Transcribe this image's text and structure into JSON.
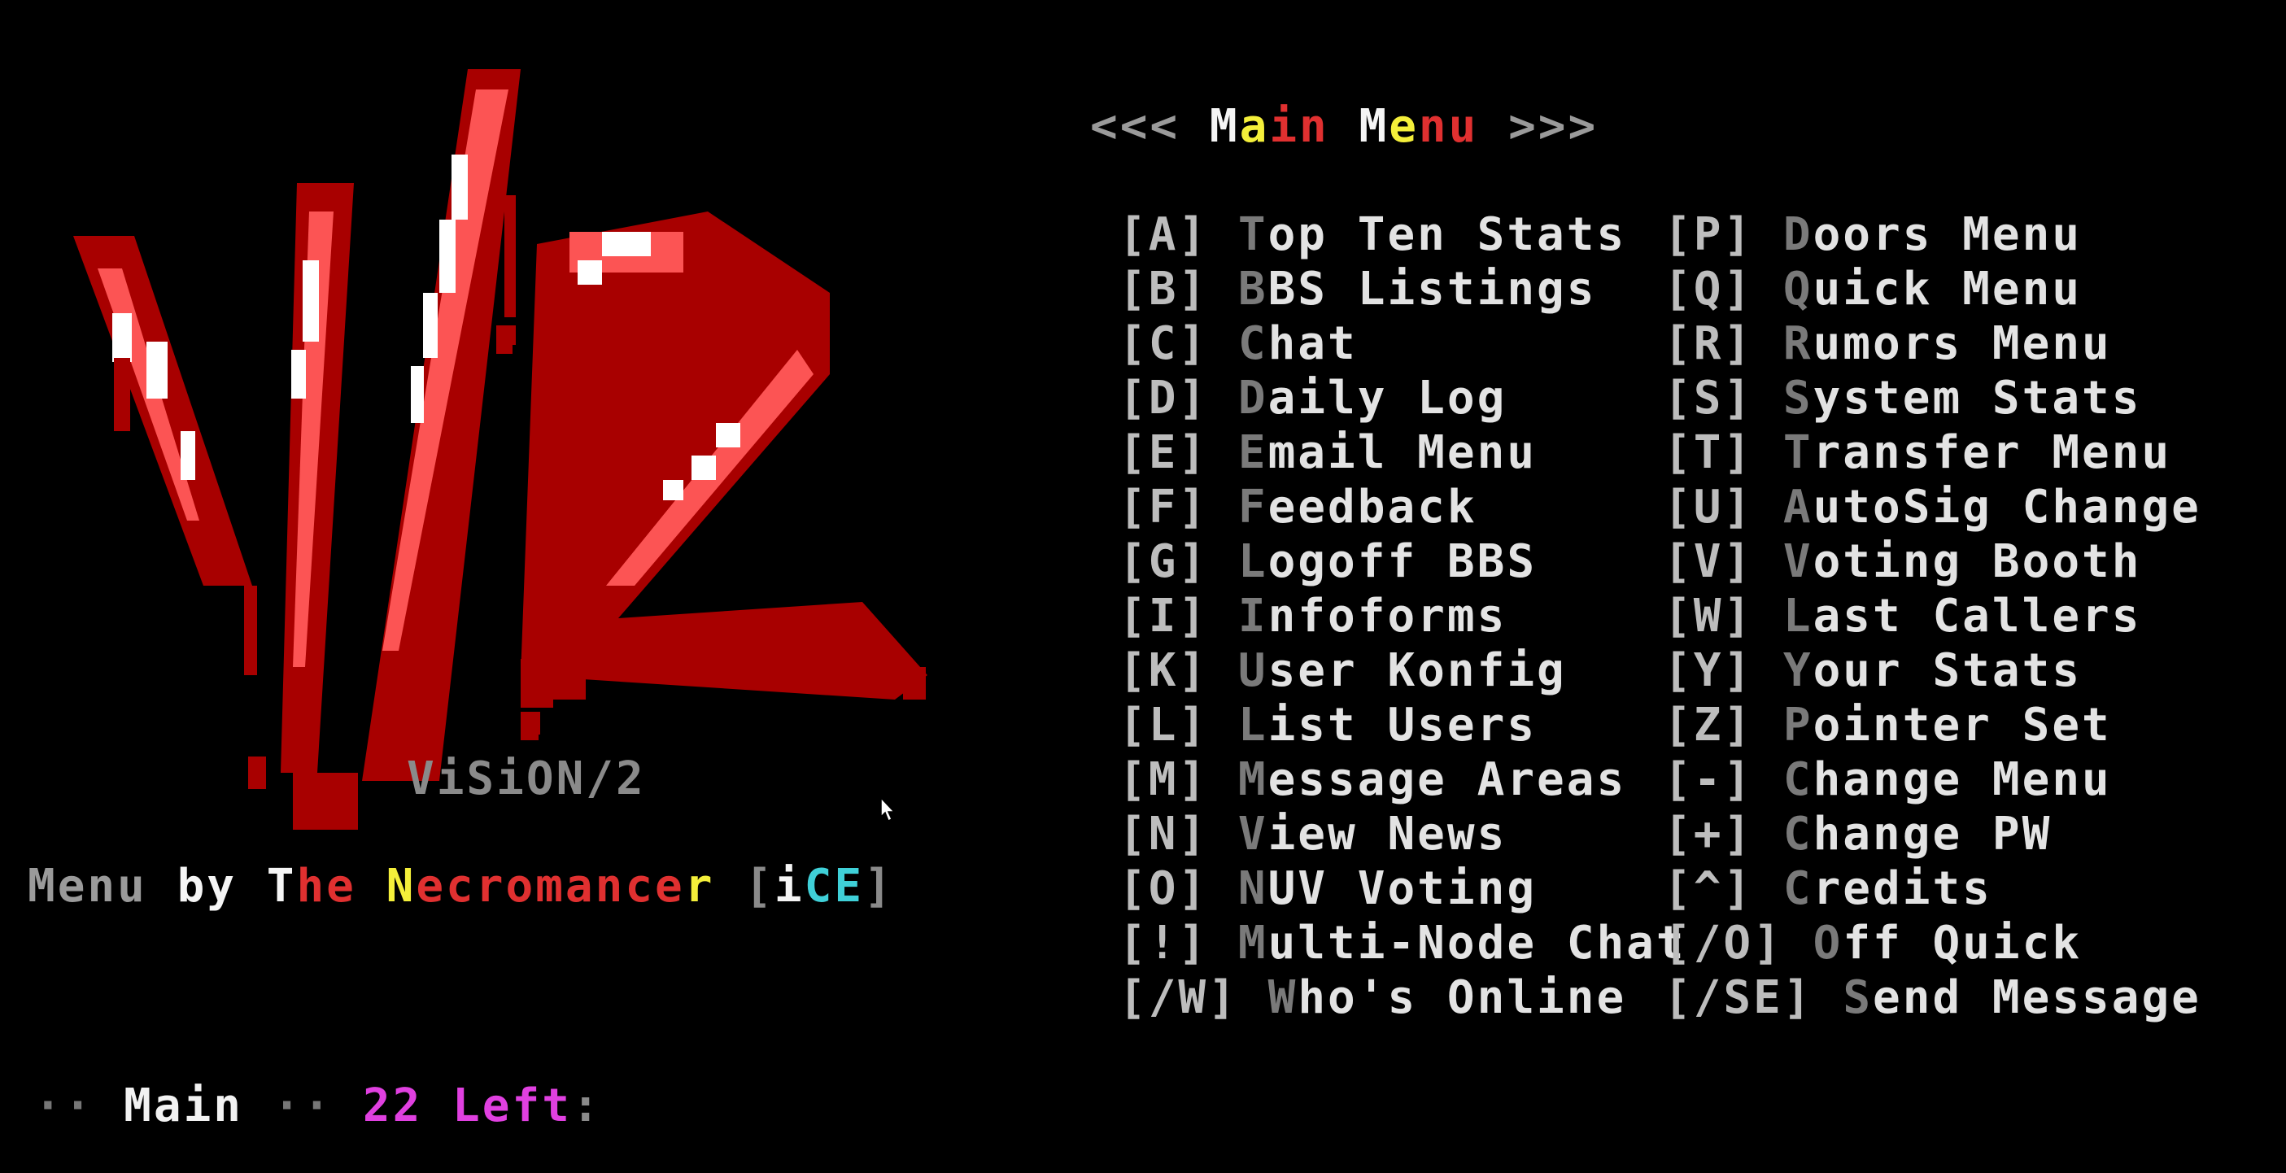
{
  "logo": {
    "caption": "ViSiON/2"
  },
  "credit": {
    "menu": "Menu",
    "by": "by",
    "t": "T",
    "he": "he",
    "n": "N",
    "ecromance": "ecromance",
    "r": "r",
    "bracket_open": "[",
    "i": "i",
    "ce": "CE",
    "bracket_close": "]"
  },
  "menu": {
    "title_left": "<<<",
    "title_m1": "M",
    "title_a": "a",
    "title_in": "in",
    "title_m2": "M",
    "title_e": "e",
    "title_nu": "nu",
    "title_right": ">>>",
    "left_items": [
      {
        "key": "A",
        "first": "T",
        "rest": "op Ten Stats"
      },
      {
        "key": "B",
        "first": "B",
        "rest": "BS Listings"
      },
      {
        "key": "C",
        "first": "C",
        "rest": "hat"
      },
      {
        "key": "D",
        "first": "D",
        "rest": "aily Log"
      },
      {
        "key": "E",
        "first": "E",
        "rest": "mail Menu"
      },
      {
        "key": "F",
        "first": "F",
        "rest": "eedback"
      },
      {
        "key": "G",
        "first": "L",
        "rest": "ogoff BBS"
      },
      {
        "key": "I",
        "first": "I",
        "rest": "nfoforms"
      },
      {
        "key": "K",
        "first": "U",
        "rest": "ser Konfig"
      },
      {
        "key": "L",
        "first": "L",
        "rest": "ist Users"
      },
      {
        "key": "M",
        "first": "M",
        "rest": "essage Areas"
      },
      {
        "key": "N",
        "first": "V",
        "rest": "iew News"
      },
      {
        "key": "O",
        "first": "N",
        "rest": "UV Voting"
      },
      {
        "key": "!",
        "first": "M",
        "rest": "ulti-Node Chat"
      },
      {
        "key": "/W",
        "first": "W",
        "rest": "ho's Online"
      }
    ],
    "right_items": [
      {
        "key": "P",
        "first": "D",
        "rest": "oors Menu"
      },
      {
        "key": "Q",
        "first": "Q",
        "rest": "uick Menu"
      },
      {
        "key": "R",
        "first": "R",
        "rest": "umors Menu"
      },
      {
        "key": "S",
        "first": "S",
        "rest": "ystem Stats"
      },
      {
        "key": "T",
        "first": "T",
        "rest": "ransfer Menu"
      },
      {
        "key": "U",
        "first": "A",
        "rest": "utoSig Change"
      },
      {
        "key": "V",
        "first": "V",
        "rest": "oting Booth"
      },
      {
        "key": "W",
        "first": "L",
        "rest": "ast Callers"
      },
      {
        "key": "Y",
        "first": "Y",
        "rest": "our Stats"
      },
      {
        "key": "Z",
        "first": "P",
        "rest": "ointer Set"
      },
      {
        "key": "-",
        "first": "C",
        "rest": "hange Menu"
      },
      {
        "key": "+",
        "first": "C",
        "rest": "hange PW"
      },
      {
        "key": "^",
        "first": "C",
        "rest": "redits"
      },
      {
        "key": "/O",
        "first": "O",
        "rest": "ff Quick"
      },
      {
        "key": "/SE",
        "first": "S",
        "rest": "end Message"
      }
    ]
  },
  "prompt": {
    "dots1": "··",
    "area": "Main",
    "dots2": "··",
    "count": "22",
    "left_label": "Left",
    "colon": ":"
  },
  "colors": {
    "background": "#000000",
    "logo_dark": "#a80000",
    "logo_light": "#fc5454",
    "logo_highlight": "#ffffff",
    "hotkey": "#bdbdbd",
    "text": "#e3e3e3",
    "accent_magenta": "#e040e0"
  }
}
